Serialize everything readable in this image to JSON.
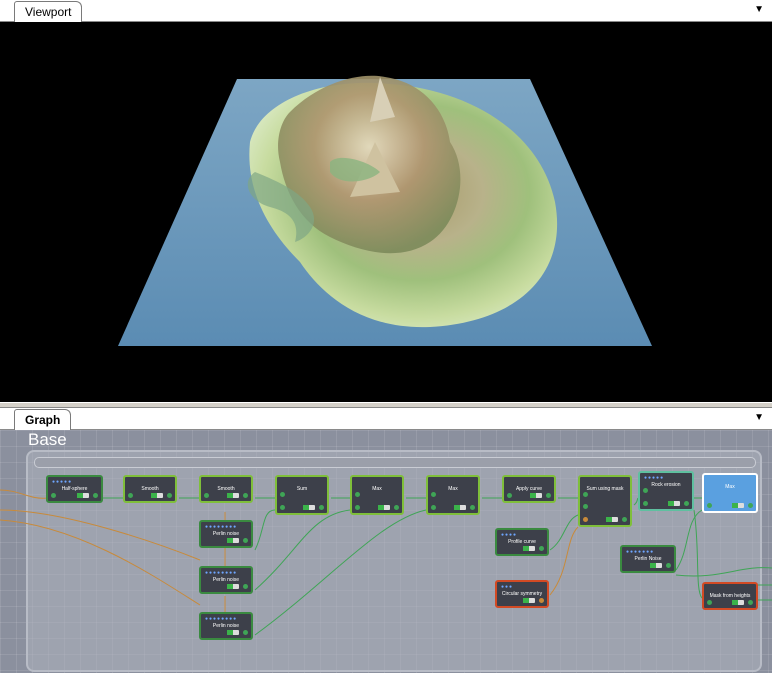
{
  "viewport": {
    "tab_label": "Viewport",
    "menu_arrow": "▼"
  },
  "graph": {
    "tab_label": "Graph",
    "menu_arrow": "▼",
    "group_title": "Base",
    "nodes": {
      "half_sphere": "Half-sphere",
      "smooth_1": "Smooth",
      "smooth_2": "Smooth",
      "sum": "Sum",
      "max_1": "Max",
      "max_2": "Max",
      "apply_curve": "Apply curve",
      "sum_using_mask": "Sum using mask",
      "rock_erosion": "Rock erosion",
      "max_selected": "Max",
      "perlin_noise_1": "Perlin noise",
      "perlin_noise_2": "Perlin noise",
      "perlin_noise_3": "Perlin noise",
      "profile_curve": "Profile curve",
      "circular_symmetry": "Circular symmetry",
      "perlin_noise_4": "Perlin Noise",
      "mask_from_heights": "Mask from heights"
    }
  },
  "colors": {
    "graph_bg": "#8b909e",
    "node_border_green": "#7fbf3a",
    "node_border_red": "#d24a24",
    "node_selected": "#5aa0e0",
    "water": "#5e8fb4"
  }
}
